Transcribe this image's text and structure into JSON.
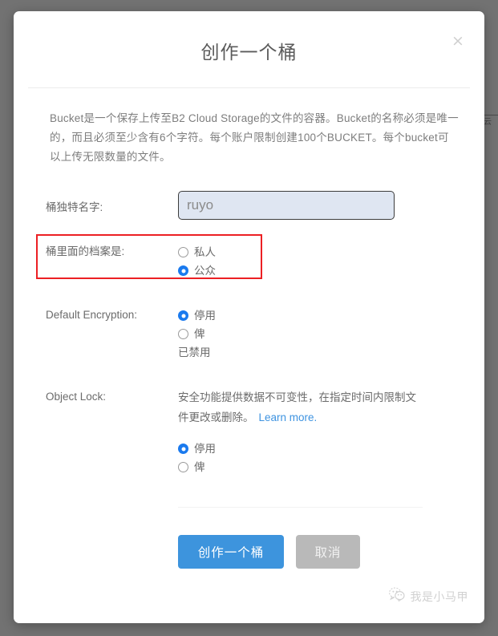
{
  "dialog": {
    "title": "创作一个桶",
    "close_icon": "close-icon",
    "intro": "Bucket是一个保存上传至B2 Cloud Storage的文件的容器。Bucket的名称必须是唯一的，而且必须至少含有6个字符。每个账户限制创建100个BUCKET。每个bucket可以上传无限数量的文件。",
    "fields": {
      "bucket_name": {
        "label": "桶独特名字:",
        "value": "ruyo",
        "placeholder": ""
      },
      "privacy": {
        "label": "桶里面的档案是:",
        "options": [
          {
            "label": "私人",
            "selected": false
          },
          {
            "label": "公众",
            "selected": true
          }
        ],
        "highlight_color": "#ec2024"
      },
      "default_encryption": {
        "label": "Default Encryption:",
        "options": [
          {
            "label": "停用",
            "selected": true
          },
          {
            "label": "俾",
            "selected": false
          }
        ],
        "note": "已禁用"
      },
      "object_lock": {
        "label": "Object Lock:",
        "description": "安全功能提供数据不可变性，在指定时间内限制文件更改或删除。",
        "learn_more": "Learn more.",
        "options": [
          {
            "label": "停用",
            "selected": true
          },
          {
            "label": "俾",
            "selected": false
          }
        ]
      }
    },
    "buttons": {
      "create": "创作一个桶",
      "cancel": "取消"
    }
  },
  "watermark": {
    "text": "我是小马甲",
    "icon": "wechat-icon"
  },
  "background": {
    "fragment": "云"
  },
  "colors": {
    "primary": "#3d94dd",
    "radio_selected": "#1a7aee",
    "link": "#3e93e0",
    "highlight": "#ec2024",
    "cancel": "#b9b9b9",
    "input_fill": "#dfe6f2"
  }
}
